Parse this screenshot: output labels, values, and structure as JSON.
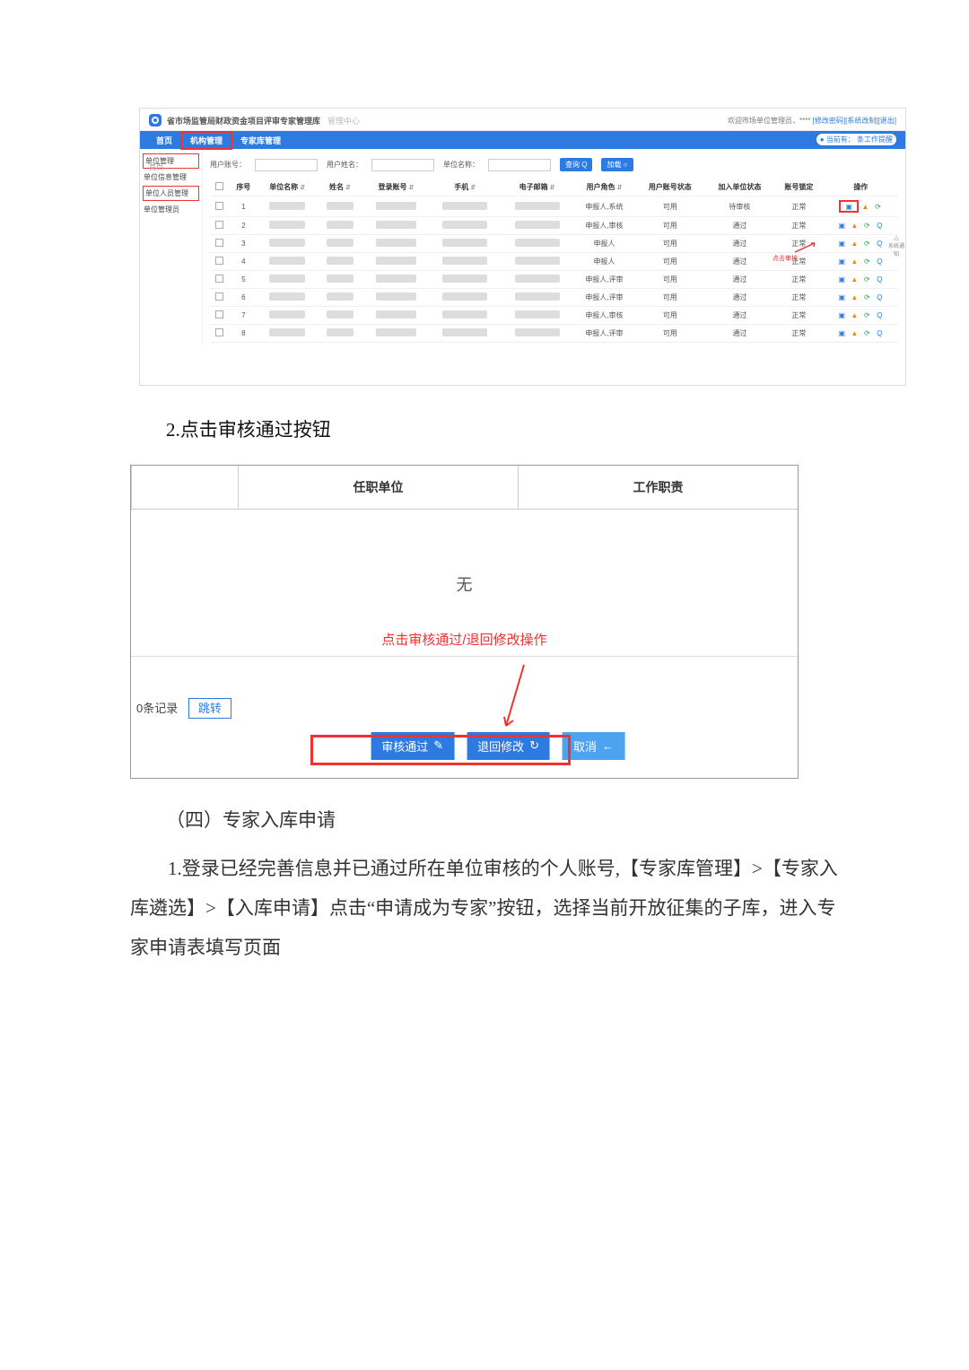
{
  "fig1": {
    "app_title": "省市场监管局财政资金项目评审专家管理库",
    "app_subtitle": "管理中心",
    "welcome_prefix": "欢迎市场单位管理员，",
    "welcome_links": "[修改密码][系统改制][退出]",
    "nav": {
      "home": "首页",
      "org_mgmt": "机构管理",
      "expert_mgmt": "专家库管理"
    },
    "breadcrumb_label": "当前有：",
    "breadcrumb_value": "条工作提醒",
    "sidebar": {
      "s1": "单位管理",
      "s2": "单位信息管理",
      "s3": "单位人员管理",
      "s4": "单位管理员"
    },
    "side_label": "首页",
    "filters": {
      "user_account": "用户账号：",
      "user_name": "用户姓名：",
      "org_name": "单位名称：",
      "btn_search": "查询 Q",
      "btn_reset": "加载 ○"
    },
    "columns": {
      "chk": "",
      "seq": "序号",
      "org": "单位名称",
      "name": "姓名",
      "login": "登录账号",
      "phone": "手机",
      "email": "电子邮箱",
      "role": "用户角色",
      "acct_status": "用户账号状态",
      "join_status": "加入单位状态",
      "lock": "账号锁定",
      "ops": "操作"
    },
    "rows": [
      {
        "seq": "1",
        "role": "申报人,系统",
        "acct": "可用",
        "join": "待审核",
        "lock": "正常"
      },
      {
        "seq": "2",
        "role": "申报人,审核",
        "acct": "可用",
        "join": "通过",
        "lock": "正常"
      },
      {
        "seq": "3",
        "role": "申报人",
        "acct": "可用",
        "join": "通过",
        "lock": "正常"
      },
      {
        "seq": "4",
        "role": "申报人",
        "acct": "可用",
        "join": "通过",
        "lock": "正常"
      },
      {
        "seq": "5",
        "role": "申报人,评审",
        "acct": "可用",
        "join": "通过",
        "lock": "正常"
      },
      {
        "seq": "6",
        "role": "申报人,评审",
        "acct": "可用",
        "join": "通过",
        "lock": "正常"
      },
      {
        "seq": "7",
        "role": "申报人,审核",
        "acct": "可用",
        "join": "通过",
        "lock": "正常"
      },
      {
        "seq": "8",
        "role": "申报人,评审",
        "acct": "可用",
        "join": "通过",
        "lock": "正常"
      }
    ],
    "annotation": "点击审核"
  },
  "instr1": "2.点击审核通过按钮",
  "fig2": {
    "col1": "",
    "col2": "任职单位",
    "col3": "工作职责",
    "none": "无",
    "redtext": "点击审核通过/退回修改操作",
    "pager_text": "0条记录",
    "pager_jump": "跳转",
    "btn_approve": "审核通过",
    "btn_return": "退回修改",
    "btn_cancel": "取消",
    "icon_approve": "✎",
    "icon_return": "↻",
    "icon_cancel": "←"
  },
  "section4_title": "（四）专家入库申请",
  "para1": "1.登录已经完善信息并已通过所在单位审核的个人账号,【专家库管理】>【专家入库遴选】>【入库申请】点击“申请成为专家”按钮，选择当前开放征集的子库，进入专家申请表填写页面"
}
